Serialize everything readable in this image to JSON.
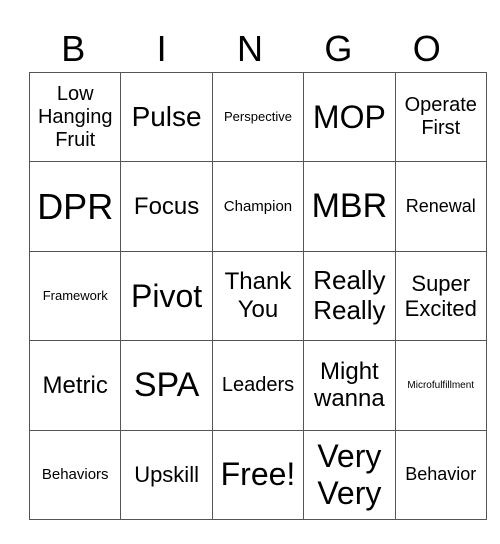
{
  "header": [
    "B",
    "I",
    "N",
    "G",
    "O"
  ],
  "rows": [
    [
      "Low Hanging Fruit",
      "Pulse",
      "Perspective",
      "MOP",
      "Operate First"
    ],
    [
      "DPR",
      "Focus",
      "Champion",
      "MBR",
      "Renewal"
    ],
    [
      "Framework",
      "Pivot",
      "Thank You",
      "Really Really",
      "Super Excited"
    ],
    [
      "Metric",
      "SPA",
      "Leaders",
      "Might wanna",
      "Microfulfillment"
    ],
    [
      "Behaviors",
      "Upskill",
      "Free!",
      "Very Very",
      "Behavior"
    ]
  ]
}
